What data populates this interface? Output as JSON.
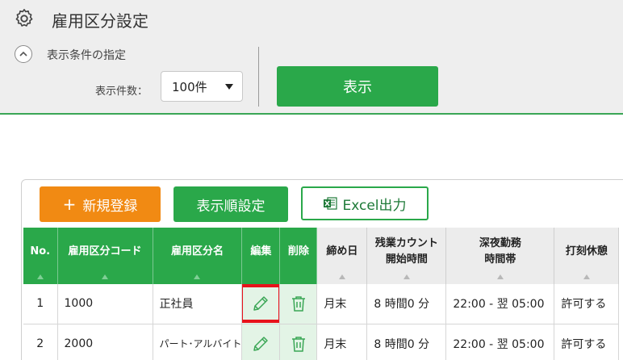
{
  "header": {
    "title": "雇用区分設定",
    "icon": "gear-icon"
  },
  "conditions": {
    "toggle_icon": "chevron-up-icon",
    "label": "表示条件の指定",
    "count_label": "表示件数：",
    "count_value": "100件",
    "show_button": "表示"
  },
  "toolbar": {
    "new_button": "新規登録",
    "new_icon": "plus-icon",
    "order_button": "表示順設定",
    "excel_button": "Excel出力",
    "excel_icon": "excel-icon"
  },
  "table": {
    "columns": [
      "No.",
      "雇用区分コード",
      "雇用区分名",
      "編集",
      "削除",
      "締め日",
      "残業カウント\n開始時間",
      "深夜勤務\n時間帯",
      "打刻休憩"
    ],
    "rows": [
      {
        "no": "1",
        "code": "1000",
        "name": "正社員",
        "closing": "月末",
        "overtime": "8 時間0 分",
        "night": "22:00 - 翌 05:00",
        "break": "許可する"
      },
      {
        "no": "2",
        "code": "2000",
        "name": "パート･アルバイト",
        "closing": "月末",
        "overtime": "8 時間0 分",
        "night": "22:00 - 翌 05:00",
        "break": "許可する"
      }
    ]
  },
  "colors": {
    "accent_green": "#2aa84a",
    "accent_orange": "#f18a13",
    "highlight_red": "#e8121b"
  }
}
